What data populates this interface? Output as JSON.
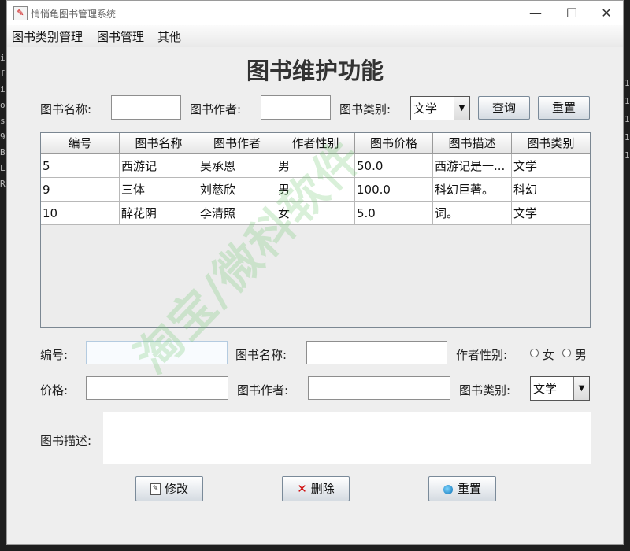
{
  "window": {
    "title": "悄悄龟图书管理系统",
    "controls": [
      "—",
      "☐",
      "✕"
    ]
  },
  "background_left_chars": [
    "ic",
    "fi",
    "in",
    "o",
    "s",
    "9",
    "B",
    "L",
    "R"
  ],
  "background_right_chars": [
    "1",
    "1",
    "1",
    "1",
    "1"
  ],
  "menu": [
    "图书类别管理",
    "图书管理",
    "其他"
  ],
  "page_title": "图书维护功能",
  "search": {
    "name_label": "图书名称:",
    "name_value": "",
    "author_label": "图书作者:",
    "author_value": "",
    "type_label": "图书类别:",
    "type_value": "文学",
    "query_button": "查询",
    "reset_button": "重置"
  },
  "table": {
    "columns": [
      "编号",
      "图书名称",
      "图书作者",
      "作者性别",
      "图书价格",
      "图书描述",
      "图书类别"
    ],
    "rows": [
      [
        "5",
        "西游记",
        "吴承恩",
        "男",
        "50.0",
        "西游记是一...",
        "文学"
      ],
      [
        "9",
        "三体",
        "刘慈欣",
        "男",
        "100.0",
        "科幻巨著。",
        "科幻"
      ],
      [
        "10",
        "醉花阴",
        "李清照",
        "女",
        "5.0",
        "词。",
        "文学"
      ]
    ]
  },
  "form": {
    "id_label": "编号:",
    "id_value": "",
    "name_label": "图书名称:",
    "name_value": "",
    "sex_label": "作者性别:",
    "sex_options": [
      "女",
      "男"
    ],
    "price_label": "价格:",
    "price_value": "",
    "author_label": "图书作者:",
    "author_value": "",
    "type_label": "图书类别:",
    "type_value": "文学",
    "desc_label": "图书描述:",
    "desc_value": ""
  },
  "actions": {
    "modify": "修改",
    "delete": "删除",
    "reset": "重置"
  },
  "watermark": "淘宝/微科软件"
}
